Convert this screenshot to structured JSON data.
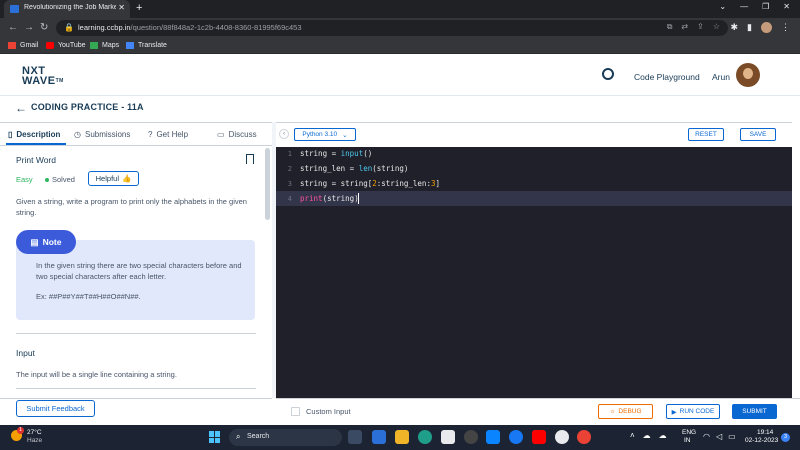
{
  "browser": {
    "tab_title": "Revolutionizing the Job Market | N",
    "url_domain": "learning.ccbp.in",
    "url_path": "/question/88f848a2-1c2b-4408-8360-81995f69c453",
    "bookmarks": [
      {
        "label": "Gmail",
        "icon": "gmail-icon",
        "color": "#ea4335"
      },
      {
        "label": "YouTube",
        "icon": "youtube-icon",
        "color": "#ff0000"
      },
      {
        "label": "Maps",
        "icon": "maps-icon",
        "color": "#34a853"
      },
      {
        "label": "Translate",
        "icon": "translate-icon",
        "color": "#4285f4"
      }
    ]
  },
  "header": {
    "logo_top": "NXT",
    "logo_bottom": "WAVE",
    "logo_tm": "TM",
    "playground_label": "Code Playground",
    "user_name": "Arun"
  },
  "titlebar": {
    "title": "CODING PRACTICE - 11A"
  },
  "left": {
    "tabs": [
      {
        "label": "Description",
        "active": true
      },
      {
        "label": "Submissions",
        "active": false
      },
      {
        "label": "Get Help",
        "active": false
      },
      {
        "label": "Discuss",
        "active": false
      }
    ],
    "question_title": "Print Word",
    "difficulty": "Easy",
    "status": "Solved",
    "helpful_label": "Helpful",
    "description": "Given a string, write a program to print only the alphabets in the given string.",
    "note_label": "Note",
    "note_text": "In the given string there are two special characters before and two special characters after each letter.",
    "note_example": "Ex: ##P##Y##T##H##O##N##.",
    "input_heading": "Input",
    "input_text": "The input will be a single line containing a string.",
    "submit_feedback": "Submit Feedback"
  },
  "editor": {
    "language": "Python 3.10",
    "reset_label": "RESET",
    "save_label": "SAVE",
    "line_numbers": [
      "1",
      "2",
      "3",
      "4"
    ],
    "code_lines": [
      "string = input()",
      "string_len = len(string)",
      "string = string[2:string_len:3]",
      "print(string)"
    ],
    "custom_input_label": "Custom Input",
    "debug_label": "DEBUG",
    "run_label": "RUN CODE",
    "submit_label": "SUBMIT"
  },
  "taskbar": {
    "temperature": "27°C",
    "condition": "Haze",
    "weather_badge": "1",
    "search_label": "Search",
    "lang_top": "ENG",
    "lang_bottom": "IN",
    "time": "19:14",
    "date": "02-12-2023",
    "notification_count": "3"
  },
  "colors": {
    "accent": "#0967d2",
    "title": "#183b56",
    "editor_bg": "#1f2029",
    "debug": "#ef6c00"
  }
}
